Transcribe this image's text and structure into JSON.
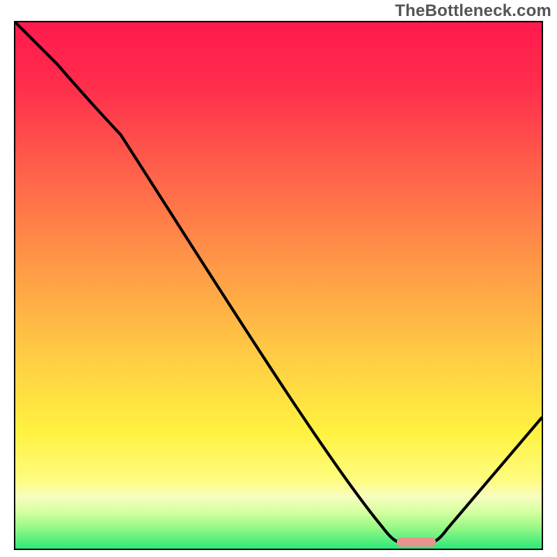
{
  "watermark": "TheBottleneck.com",
  "colors": {
    "gradient_top": "#ff1a4d",
    "gradient_mid_upper": "#ff9547",
    "gradient_mid": "#fff241",
    "gradient_lower": "#f7fdbe",
    "gradient_bottom": "#2ee87a",
    "curve": "#000000",
    "marker": "#e8938f",
    "frame": "#000000"
  },
  "chart_data": {
    "type": "line",
    "title": "",
    "xlabel": "",
    "ylabel": "",
    "xlim": [
      0,
      100
    ],
    "ylim": [
      0,
      100
    ],
    "series": [
      {
        "name": "bottleneck-curve",
        "x": [
          0,
          20,
          70,
          74,
          78,
          100
        ],
        "values": [
          100,
          80,
          4,
          1,
          1,
          25
        ]
      }
    ],
    "annotations": [
      {
        "name": "min-marker",
        "x_center": 76,
        "y": 1,
        "width_pct": 7
      }
    ]
  }
}
